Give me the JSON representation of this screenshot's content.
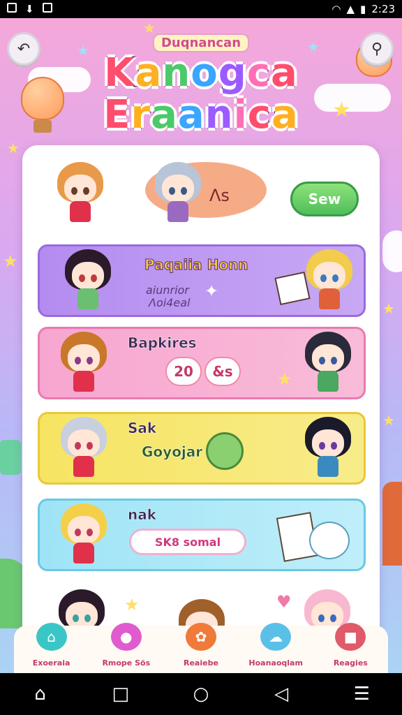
{
  "status_bar": {
    "time": "2:23"
  },
  "header": {
    "back_icon": "back-arrow-icon",
    "search_icon": "magnifier-icon",
    "logo_subtitle": "Duqnancan",
    "logo_line1": "Kanogca",
    "logo_line2": "Eraanica"
  },
  "top_row": {
    "speech_text": "Λs",
    "play_label": "Sew"
  },
  "cards": [
    {
      "title": "Paqaiia Honn",
      "desc1": "aiunrior",
      "desc2": "Λoi4eal",
      "color": "#b48cf0"
    },
    {
      "title": "Bapkires",
      "pill1": "20",
      "pill2": "&s",
      "color": "#f7a6d0"
    },
    {
      "title": "Sak",
      "subtitle": "Goyojar",
      "color": "#f6e462"
    },
    {
      "title": "nak",
      "pill_text": "SK8 somal",
      "color": "#9ee4f6"
    }
  ],
  "tabs": [
    {
      "label": "Exoeraia",
      "icon": "house-icon",
      "color": "#3ac6c6"
    },
    {
      "label": "Rmope Sös",
      "icon": "bubble-icon",
      "color": "#e05ad0"
    },
    {
      "label": "Reaiebe",
      "icon": "strawberry-icon",
      "color": "#f07a3a"
    },
    {
      "label": "Hoanaoqlam",
      "icon": "ghost-icon",
      "color": "#5ac0e8"
    },
    {
      "label": "Reagies",
      "icon": "gift-icon",
      "color": "#e05a6a"
    }
  ]
}
